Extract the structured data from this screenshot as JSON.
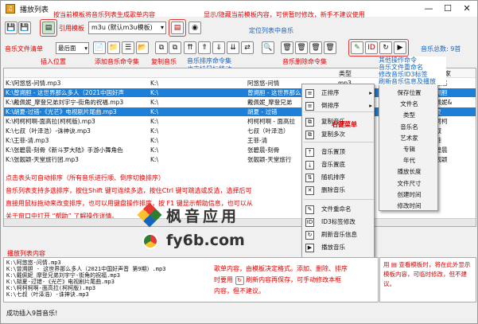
{
  "window": {
    "title": "播放列表",
    "minimize": "—",
    "maximize": "☐",
    "close": "✕"
  },
  "toolbar": {
    "template_label": "引用模板",
    "template_value": "m3u  (默认m3u模板)"
  },
  "notes": {
    "pick_template": "按当前模板将音乐列表生成歌单内容",
    "toggle_template": "显示/隐藏当前模板内容，可供暂时修改，新手不建议使用",
    "locate": "定位列表中音乐",
    "insert_pos": "插入位置",
    "add_content": "添加音乐命令集",
    "copy_cmd": "复制音乐",
    "sort_cmd": "音乐排序命令集",
    "sort_cmd2": "也支持鼠标移动",
    "delete_cmd": "音乐删除命令集",
    "other_ops": [
      "其他操作命令",
      "音乐文件重命名",
      "修改音乐ID3标签",
      "刷新音乐信息及播放"
    ],
    "click_header": "点击表头可自动排序（所有音乐进行顺、倒序切换排序）",
    "multi_select": "音乐列表支持多选排序，按住Shift 键可连续多选，按住Ctrl 键可跳选或反选，选择后可",
    "drag_tip": "直接用鼠标拖动来改变排序，也可以用键盘操作排序，按 F1 键显示帮助信息，也可以从",
    "help_tip": "关于窗口中打开 “帮助” 了解操作详情。",
    "right_menu": "右键菜单",
    "edit_tip": "歌单内容，由模板决定格式。添加、删除、排序",
    "edit_tip2": "时要用",
    "edit_tip3": "刷新内容再保存，可手动修改本框",
    "edit_tip4": "内容，但不建议。",
    "side_note": "查看模板时，将在此外显示模板内容，可临时修改，但不建议。",
    "side_note_prefix": "用"
  },
  "filter": {
    "label": "音乐文件清单",
    "position": "最后面",
    "music_count": "音乐总数: 9首",
    "type_col": "类型",
    "artist_col": "艺术家"
  },
  "rows": [
    {
      "path": "K:\\阿悠悠-问情.mp3",
      "dir": "K:\\",
      "name": "阿悠悠-问情",
      "type": "mp3",
      "artist": "阿悠悠",
      "sel": false
    },
    {
      "path": "K:\\曾溯胆 - 这世界那么多人（2021中国好声",
      "dir": "K:\\",
      "name": "曾溯胆 - 这世界那么",
      "type": "mp3",
      "artist": "曾溯胆",
      "sel": true
    },
    {
      "path": "K:\\戴佩妮_摩登兄弟刘宇宁-街角的祝福.mp3",
      "dir": "K:\\",
      "name": "戴佩妮_摩登兄弟",
      "type": "mp3",
      "artist": "戴佩妮&",
      "sel": false
    },
    {
      "path": "K:\\胡夏-过错-《光芒》电视剧片尾曲.mp3",
      "dir": "K:\\",
      "name": "胡夏 - 过错",
      "type": "mp3",
      "artist": "胡夏",
      "sel": true
    },
    {
      "path": "K:\\柯柯柯啊-面高拉(柯柯版).mp3",
      "dir": "K:\\",
      "name": "柯柯柯啊 - 面高拉",
      "type": "mp3",
      "artist": "柯柯柯",
      "sel": false
    },
    {
      "path": "K:\\七叔（叶泽浩）-诛神诀.mp3",
      "dir": "K:\\",
      "name": "七叔（叶泽浩）",
      "type": "mp3",
      "artist": "七叔",
      "sel": false
    },
    {
      "path": "K:\\王菲-清.mp3",
      "dir": "K:\\",
      "name": "王菲-清",
      "type": "mp3",
      "artist": "王菲",
      "sel": false
    },
    {
      "path": "K:\\张碧晨-刻骨《新斗罗大陆》手游小舞角色",
      "dir": "K:\\",
      "name": "张碧晨-刻骨",
      "type": "mp3",
      "artist": "张碧晨",
      "sel": false
    },
    {
      "path": "K:\\张靓颖-天堂旅行团.mp3",
      "dir": "K:\\",
      "name": "张靓颖-天堂旅行",
      "type": "mp3",
      "artist": "张靓颖",
      "sel": false
    }
  ],
  "context_menu": [
    {
      "icon": "≡",
      "label": "正排序",
      "arrow": "▸"
    },
    {
      "icon": "≡",
      "label": "倒排序",
      "arrow": "▸"
    },
    {
      "icon": "⧉",
      "label": "复制音乐",
      "arrow": ""
    },
    {
      "icon": "⧉",
      "label": "复制多次",
      "arrow": ""
    },
    {
      "icon": "⤒",
      "label": "音乐置顶",
      "arrow": ""
    },
    {
      "icon": "⤓",
      "label": "音乐置底",
      "arrow": ""
    },
    {
      "icon": "⇅",
      "label": "随机排序",
      "arrow": ""
    },
    {
      "icon": "✕",
      "label": "删除音乐",
      "arrow": ""
    },
    {
      "icon": "✎",
      "label": "文件重命名",
      "arrow": ""
    },
    {
      "icon": "ID",
      "label": "ID3标签修改",
      "arrow": ""
    },
    {
      "icon": "↻",
      "label": "刷新音乐信息",
      "arrow": ""
    },
    {
      "icon": "▶",
      "label": "播放音乐",
      "arrow": ""
    }
  ],
  "submenu": [
    "保存位置",
    "文件名",
    "类型",
    "音乐名",
    "艺术家",
    "专辑",
    "年代",
    "播放长度",
    "文件尺寸",
    "创建时间",
    "修改时间"
  ],
  "editor": {
    "title": "播放列表内容",
    "lines": [
      "K:\\阿悠悠-问情.mp3",
      "K:\\曾溯胆 - 这世界那么多人（2021中国好声音 第9期）.mp3",
      "K:\\戴佩妮_摩登兄弟刘宇宁-街角的祝福.mp3",
      "K:\\胡夏-过错-《光芒》电视剧片尾曲.mp3",
      "K:\\柯柯柯啊-面高拉(柯柯版).mp3",
      "K:\\七叔（叶泽浩）-诛神诀.mp3"
    ]
  },
  "watermark": {
    "brand": "枫音应用",
    "url": "fy6b.com"
  },
  "status": "成功插入9首音乐!"
}
